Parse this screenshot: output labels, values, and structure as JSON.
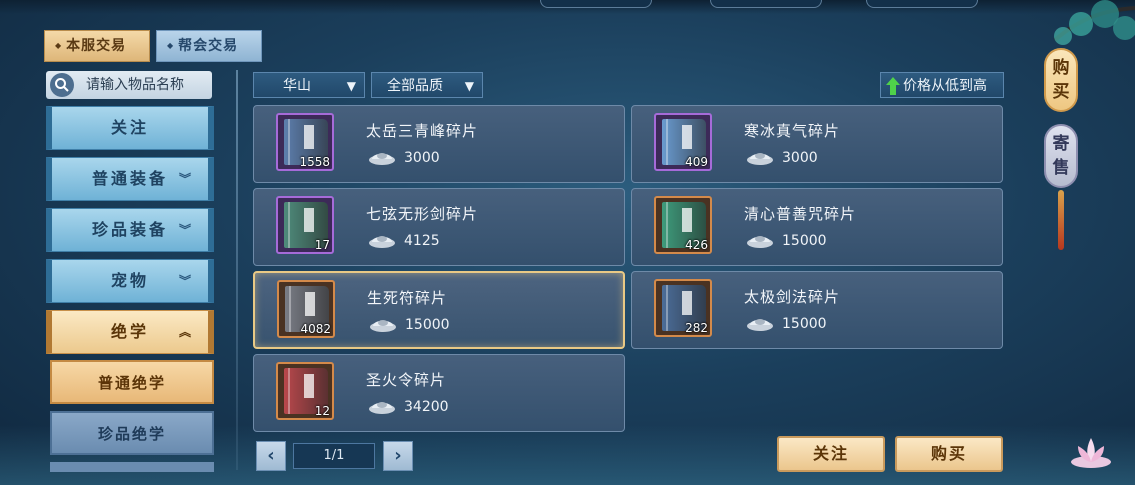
{
  "tabs": [
    {
      "label": "本服交易",
      "active": true
    },
    {
      "label": "帮会交易",
      "active": false
    }
  ],
  "search": {
    "placeholder": "请输入物品名称",
    "icon": "search-icon"
  },
  "categories": [
    {
      "label": "关注",
      "has_chevron": false
    },
    {
      "label": "普通装备",
      "has_chevron": true
    },
    {
      "label": "珍品装备",
      "has_chevron": true
    },
    {
      "label": "宠物",
      "has_chevron": true
    },
    {
      "label": "绝学",
      "has_chevron": true,
      "expanded": true
    }
  ],
  "subcategories": [
    {
      "label": "普通绝学",
      "active": true
    },
    {
      "label": "珍品绝学",
      "active": false
    }
  ],
  "filters": {
    "sect": "华山",
    "quality": "全部品质",
    "sort": "价格从低到高"
  },
  "items": [
    {
      "name": "太岳三青峰碎片",
      "price": "3000",
      "qty": "1558",
      "frame": "purple",
      "book_color": "#5d7fae"
    },
    {
      "name": "寒冰真气碎片",
      "price": "3000",
      "qty": "409",
      "frame": "purple",
      "book_color": "#6a9bd0"
    },
    {
      "name": "七弦无形剑碎片",
      "price": "4125",
      "qty": "17",
      "frame": "purple",
      "book_color": "#4f8c7c"
    },
    {
      "name": "清心普善咒碎片",
      "price": "15000",
      "qty": "426",
      "frame": "orange",
      "book_color": "#3e9c7c"
    },
    {
      "name": "生死符碎片",
      "price": "15000",
      "qty": "4082",
      "frame": "orange",
      "book_color": "#7a7d86",
      "selected": true
    },
    {
      "name": "太极剑法碎片",
      "price": "15000",
      "qty": "282",
      "frame": "orange",
      "book_color": "#4b6d99"
    },
    {
      "name": "圣火令碎片",
      "price": "34200",
      "qty": "12",
      "frame": "orange",
      "book_color": "#b9484c"
    }
  ],
  "pagination": {
    "current": "1/1",
    "prev_icon": "chevron-left-icon",
    "next_icon": "chevron-right-icon"
  },
  "actions": {
    "follow": "关注",
    "buy": "购买"
  },
  "side_tabs": [
    {
      "label": "购买",
      "active": true
    },
    {
      "label": "寄售",
      "active": false
    }
  ],
  "currency_icon": "silver-ingot-icon",
  "colors": {
    "gold_frame": "#e9c985",
    "purple_frame": "#a66bd9",
    "orange_frame": "#d48a4a"
  }
}
